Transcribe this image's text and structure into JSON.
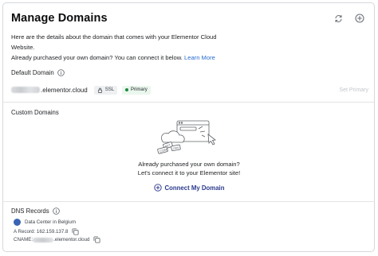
{
  "header": {
    "title": "Manage Domains",
    "refresh_icon": "refresh-icon",
    "add_icon": "plus-circle-icon"
  },
  "intro": {
    "line1": "Here are the details about the domain that comes with your Elementor Cloud",
    "line2": "Website.",
    "line3": "Already purchased your own domain? You can connect it below.",
    "learn_more": "Learn More"
  },
  "default_domain": {
    "label": "Default Domain",
    "domain_suffix": ".elementor.cloud",
    "ssl_label": "SSL",
    "primary_label": "Primary",
    "set_primary": "Set Primary"
  },
  "custom_domains": {
    "label": "Custom Domains",
    "empty_line1": "Already purchased your own domain?",
    "empty_line2": "Let's connect it to your Elementor site!",
    "connect_label": "Connect My Domain",
    "illustration_text_com": ".COM",
    "illustration_text_net": ".NET",
    "illustration_text_org": ".ORG"
  },
  "dns": {
    "label": "DNS Records",
    "datacenter": "Data Center in Belgium",
    "a_record": "A Record: 162.159.137.8",
    "cname_prefix": "CNAME:",
    "cname_suffix": ".elementor.cloud"
  },
  "colors": {
    "accent_link": "#2b6cd1",
    "connect_blue": "#2b3a8c",
    "primary_dot": "#1e8a3e",
    "flag_blue": "#3a64b4"
  }
}
